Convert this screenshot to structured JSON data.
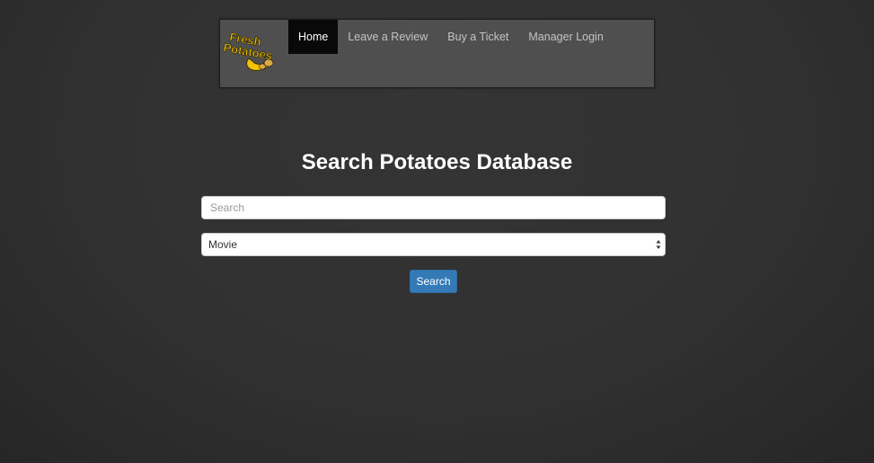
{
  "navbar": {
    "logo_alt": "Fresh Potatoes",
    "items": [
      {
        "label": "Home",
        "active": true
      },
      {
        "label": "Leave a Review",
        "active": false
      },
      {
        "label": "Buy a Ticket",
        "active": false
      },
      {
        "label": "Manager Login",
        "active": false
      }
    ]
  },
  "main": {
    "title": "Search Potatoes Database",
    "search": {
      "placeholder": "Search",
      "value": ""
    },
    "category_select": {
      "selected": "Movie"
    },
    "search_button_label": "Search"
  },
  "colors": {
    "background": "#313131",
    "navbar_bg": "#4f4f4f",
    "nav_active_bg": "#090909",
    "nav_text": "#c3c3c3",
    "button_primary": "#337ab7",
    "logo_text": "#f2c200"
  }
}
